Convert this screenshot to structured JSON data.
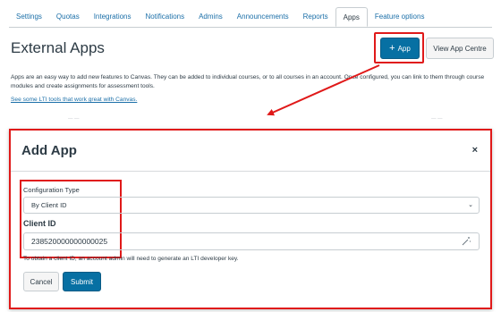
{
  "tabs": [
    {
      "label": "Settings"
    },
    {
      "label": "Quotas"
    },
    {
      "label": "Integrations"
    },
    {
      "label": "Notifications"
    },
    {
      "label": "Admins"
    },
    {
      "label": "Announcements"
    },
    {
      "label": "Reports"
    },
    {
      "label": "Apps",
      "active": true
    },
    {
      "label": "Feature options"
    }
  ],
  "header": {
    "title": "External Apps",
    "add_app_label": "App",
    "add_app_icon": "+",
    "view_centre_label": "View App Centre"
  },
  "description": "Apps are an easy way to add new features to Canvas. They can be added to individual courses, or to all courses in an account. Once configured, you can link to them through course modules and create assignments for assessment tools.",
  "lti_link": "See some LTI tools that work great with Canvas.",
  "modal": {
    "title": "Add App",
    "close_icon": "×",
    "config_type_label": "Configuration Type",
    "config_type_value": "By Client ID",
    "client_id_label": "Client ID",
    "client_id_value": "238520000000000025",
    "help_text": "To obtain a client ID, an account admin will need to generate an LTI developer key.",
    "cancel_label": "Cancel",
    "submit_label": "Submit"
  },
  "colors": {
    "primary": "#0770a3",
    "highlight": "#e01919",
    "link": "#1b6fa8"
  }
}
